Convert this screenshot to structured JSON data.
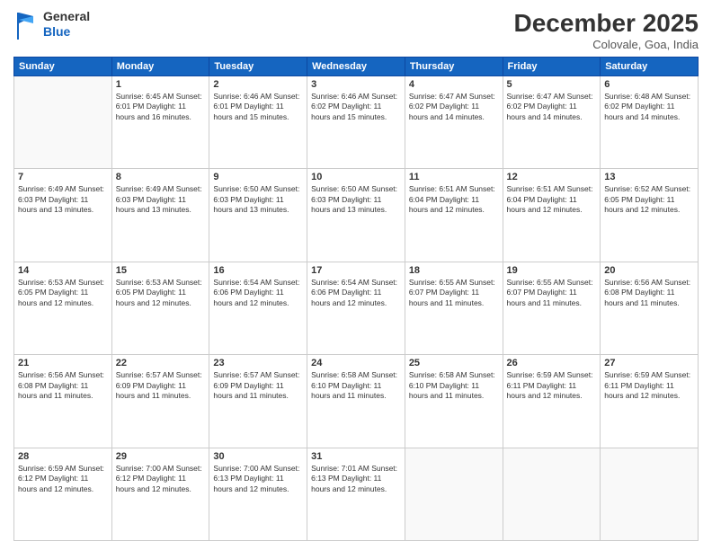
{
  "header": {
    "logo_line1": "General",
    "logo_line2": "Blue",
    "month_title": "December 2025",
    "location": "Colovale, Goa, India"
  },
  "days_of_week": [
    "Sunday",
    "Monday",
    "Tuesday",
    "Wednesday",
    "Thursday",
    "Friday",
    "Saturday"
  ],
  "weeks": [
    [
      {
        "day": "",
        "info": ""
      },
      {
        "day": "1",
        "info": "Sunrise: 6:45 AM\nSunset: 6:01 PM\nDaylight: 11 hours\nand 16 minutes."
      },
      {
        "day": "2",
        "info": "Sunrise: 6:46 AM\nSunset: 6:01 PM\nDaylight: 11 hours\nand 15 minutes."
      },
      {
        "day": "3",
        "info": "Sunrise: 6:46 AM\nSunset: 6:02 PM\nDaylight: 11 hours\nand 15 minutes."
      },
      {
        "day": "4",
        "info": "Sunrise: 6:47 AM\nSunset: 6:02 PM\nDaylight: 11 hours\nand 14 minutes."
      },
      {
        "day": "5",
        "info": "Sunrise: 6:47 AM\nSunset: 6:02 PM\nDaylight: 11 hours\nand 14 minutes."
      },
      {
        "day": "6",
        "info": "Sunrise: 6:48 AM\nSunset: 6:02 PM\nDaylight: 11 hours\nand 14 minutes."
      }
    ],
    [
      {
        "day": "7",
        "info": "Sunrise: 6:49 AM\nSunset: 6:03 PM\nDaylight: 11 hours\nand 13 minutes."
      },
      {
        "day": "8",
        "info": "Sunrise: 6:49 AM\nSunset: 6:03 PM\nDaylight: 11 hours\nand 13 minutes."
      },
      {
        "day": "9",
        "info": "Sunrise: 6:50 AM\nSunset: 6:03 PM\nDaylight: 11 hours\nand 13 minutes."
      },
      {
        "day": "10",
        "info": "Sunrise: 6:50 AM\nSunset: 6:03 PM\nDaylight: 11 hours\nand 13 minutes."
      },
      {
        "day": "11",
        "info": "Sunrise: 6:51 AM\nSunset: 6:04 PM\nDaylight: 11 hours\nand 12 minutes."
      },
      {
        "day": "12",
        "info": "Sunrise: 6:51 AM\nSunset: 6:04 PM\nDaylight: 11 hours\nand 12 minutes."
      },
      {
        "day": "13",
        "info": "Sunrise: 6:52 AM\nSunset: 6:05 PM\nDaylight: 11 hours\nand 12 minutes."
      }
    ],
    [
      {
        "day": "14",
        "info": "Sunrise: 6:53 AM\nSunset: 6:05 PM\nDaylight: 11 hours\nand 12 minutes."
      },
      {
        "day": "15",
        "info": "Sunrise: 6:53 AM\nSunset: 6:05 PM\nDaylight: 11 hours\nand 12 minutes."
      },
      {
        "day": "16",
        "info": "Sunrise: 6:54 AM\nSunset: 6:06 PM\nDaylight: 11 hours\nand 12 minutes."
      },
      {
        "day": "17",
        "info": "Sunrise: 6:54 AM\nSunset: 6:06 PM\nDaylight: 11 hours\nand 12 minutes."
      },
      {
        "day": "18",
        "info": "Sunrise: 6:55 AM\nSunset: 6:07 PM\nDaylight: 11 hours\nand 11 minutes."
      },
      {
        "day": "19",
        "info": "Sunrise: 6:55 AM\nSunset: 6:07 PM\nDaylight: 11 hours\nand 11 minutes."
      },
      {
        "day": "20",
        "info": "Sunrise: 6:56 AM\nSunset: 6:08 PM\nDaylight: 11 hours\nand 11 minutes."
      }
    ],
    [
      {
        "day": "21",
        "info": "Sunrise: 6:56 AM\nSunset: 6:08 PM\nDaylight: 11 hours\nand 11 minutes."
      },
      {
        "day": "22",
        "info": "Sunrise: 6:57 AM\nSunset: 6:09 PM\nDaylight: 11 hours\nand 11 minutes."
      },
      {
        "day": "23",
        "info": "Sunrise: 6:57 AM\nSunset: 6:09 PM\nDaylight: 11 hours\nand 11 minutes."
      },
      {
        "day": "24",
        "info": "Sunrise: 6:58 AM\nSunset: 6:10 PM\nDaylight: 11 hours\nand 11 minutes."
      },
      {
        "day": "25",
        "info": "Sunrise: 6:58 AM\nSunset: 6:10 PM\nDaylight: 11 hours\nand 11 minutes."
      },
      {
        "day": "26",
        "info": "Sunrise: 6:59 AM\nSunset: 6:11 PM\nDaylight: 11 hours\nand 12 minutes."
      },
      {
        "day": "27",
        "info": "Sunrise: 6:59 AM\nSunset: 6:11 PM\nDaylight: 11 hours\nand 12 minutes."
      }
    ],
    [
      {
        "day": "28",
        "info": "Sunrise: 6:59 AM\nSunset: 6:12 PM\nDaylight: 11 hours\nand 12 minutes."
      },
      {
        "day": "29",
        "info": "Sunrise: 7:00 AM\nSunset: 6:12 PM\nDaylight: 11 hours\nand 12 minutes."
      },
      {
        "day": "30",
        "info": "Sunrise: 7:00 AM\nSunset: 6:13 PM\nDaylight: 11 hours\nand 12 minutes."
      },
      {
        "day": "31",
        "info": "Sunrise: 7:01 AM\nSunset: 6:13 PM\nDaylight: 11 hours\nand 12 minutes."
      },
      {
        "day": "",
        "info": ""
      },
      {
        "day": "",
        "info": ""
      },
      {
        "day": "",
        "info": ""
      }
    ]
  ]
}
